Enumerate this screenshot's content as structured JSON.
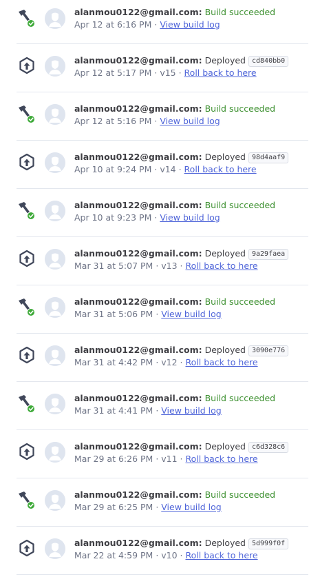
{
  "feed": {
    "items": [
      {
        "kind": "build",
        "email": "alanmou0122@gmail.com:",
        "status": "Build succeeded",
        "time": "Apr 12 at 6:16 PM",
        "link": "View build log"
      },
      {
        "kind": "deploy",
        "email": "alanmou0122@gmail.com:",
        "status": "Deployed",
        "hash": "cd840bb0",
        "time": "Apr 12 at 5:17 PM",
        "version": "v15",
        "link": "Roll back to here"
      },
      {
        "kind": "build",
        "email": "alanmou0122@gmail.com:",
        "status": "Build succeeded",
        "time": "Apr 12 at 5:16 PM",
        "link": "View build log"
      },
      {
        "kind": "deploy",
        "email": "alanmou0122@gmail.com:",
        "status": "Deployed",
        "hash": "98d4aaf9",
        "time": "Apr 10 at 9:24 PM",
        "version": "v14",
        "link": "Roll back to here"
      },
      {
        "kind": "build",
        "email": "alanmou0122@gmail.com:",
        "status": "Build succeeded",
        "time": "Apr 10 at 9:23 PM",
        "link": "View build log"
      },
      {
        "kind": "deploy",
        "email": "alanmou0122@gmail.com:",
        "status": "Deployed",
        "hash": "9a29faea",
        "time": "Mar 31 at 5:07 PM",
        "version": "v13",
        "link": "Roll back to here"
      },
      {
        "kind": "build",
        "email": "alanmou0122@gmail.com:",
        "status": "Build succeeded",
        "time": "Mar 31 at 5:06 PM",
        "link": "View build log"
      },
      {
        "kind": "deploy",
        "email": "alanmou0122@gmail.com:",
        "status": "Deployed",
        "hash": "3090e776",
        "time": "Mar 31 at 4:42 PM",
        "version": "v12",
        "link": "Roll back to here"
      },
      {
        "kind": "build",
        "email": "alanmou0122@gmail.com:",
        "status": "Build succeeded",
        "time": "Mar 31 at 4:41 PM",
        "link": "View build log"
      },
      {
        "kind": "deploy",
        "email": "alanmou0122@gmail.com:",
        "status": "Deployed",
        "hash": "c6d328c6",
        "time": "Mar 29 at 6:26 PM",
        "version": "v11",
        "link": "Roll back to here"
      },
      {
        "kind": "build",
        "email": "alanmou0122@gmail.com:",
        "status": "Build succeeded",
        "time": "Mar 29 at 6:25 PM",
        "link": "View build log"
      },
      {
        "kind": "deploy",
        "email": "alanmou0122@gmail.com:",
        "status": "Deployed",
        "hash": "5d999f0f",
        "time": "Mar 22 at 4:59 PM",
        "version": "v10",
        "link": "Roll back to here"
      }
    ]
  },
  "icons": {
    "build": "hammer-icon",
    "build_badge": "check-circle-icon",
    "deploy": "upload-arrow-icon",
    "avatar": "user-avatar-icon"
  },
  "colors": {
    "success": "#3b8f2e",
    "link": "#4f65d9",
    "muted": "#6f7587",
    "divider": "#e3e7ee",
    "avatar_bg": "#dfe5ef"
  }
}
